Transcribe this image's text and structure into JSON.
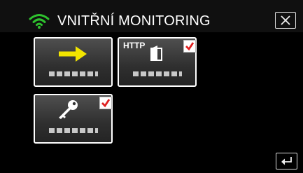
{
  "header": {
    "title": "VNITŘNÍ MONITORING",
    "wifi_icon": "wifi-icon",
    "close_icon": "close-icon"
  },
  "tiles": [
    {
      "name": "tile-arrow",
      "icon": "yellow-arrow-icon",
      "checked": false,
      "label_masked": true
    },
    {
      "name": "tile-http",
      "icon_text": "HTTP",
      "icon": "http-door-icon",
      "checked": true,
      "label_masked": true
    },
    {
      "name": "tile-key",
      "icon": "key-icon",
      "checked": true,
      "label_masked": true
    }
  ],
  "footer": {
    "back_icon": "return-icon"
  },
  "colors": {
    "background": "#000000",
    "tile_border": "#ffffff",
    "arrow": "#f2e500",
    "check": "#e02020"
  }
}
